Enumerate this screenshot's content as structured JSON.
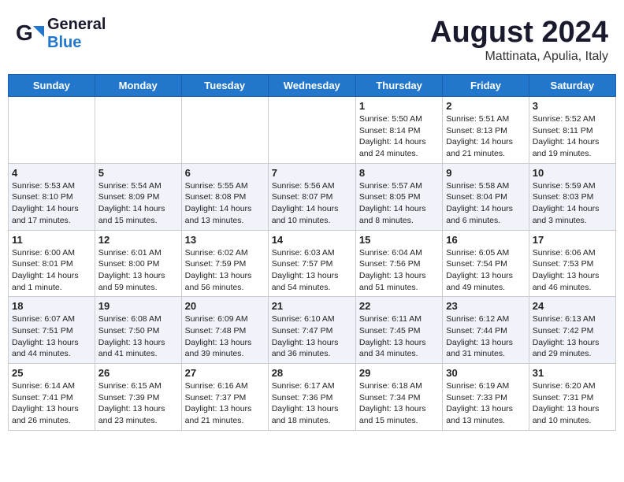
{
  "logo": {
    "general": "General",
    "blue": "Blue"
  },
  "title": "August 2024",
  "subtitle": "Mattinata, Apulia, Italy",
  "days_of_week": [
    "Sunday",
    "Monday",
    "Tuesday",
    "Wednesday",
    "Thursday",
    "Friday",
    "Saturday"
  ],
  "weeks": [
    [
      {
        "day": "",
        "content": ""
      },
      {
        "day": "",
        "content": ""
      },
      {
        "day": "",
        "content": ""
      },
      {
        "day": "",
        "content": ""
      },
      {
        "day": "1",
        "content": "Sunrise: 5:50 AM\nSunset: 8:14 PM\nDaylight: 14 hours\nand 24 minutes."
      },
      {
        "day": "2",
        "content": "Sunrise: 5:51 AM\nSunset: 8:13 PM\nDaylight: 14 hours\nand 21 minutes."
      },
      {
        "day": "3",
        "content": "Sunrise: 5:52 AM\nSunset: 8:11 PM\nDaylight: 14 hours\nand 19 minutes."
      }
    ],
    [
      {
        "day": "4",
        "content": "Sunrise: 5:53 AM\nSunset: 8:10 PM\nDaylight: 14 hours\nand 17 minutes."
      },
      {
        "day": "5",
        "content": "Sunrise: 5:54 AM\nSunset: 8:09 PM\nDaylight: 14 hours\nand 15 minutes."
      },
      {
        "day": "6",
        "content": "Sunrise: 5:55 AM\nSunset: 8:08 PM\nDaylight: 14 hours\nand 13 minutes."
      },
      {
        "day": "7",
        "content": "Sunrise: 5:56 AM\nSunset: 8:07 PM\nDaylight: 14 hours\nand 10 minutes."
      },
      {
        "day": "8",
        "content": "Sunrise: 5:57 AM\nSunset: 8:05 PM\nDaylight: 14 hours\nand 8 minutes."
      },
      {
        "day": "9",
        "content": "Sunrise: 5:58 AM\nSunset: 8:04 PM\nDaylight: 14 hours\nand 6 minutes."
      },
      {
        "day": "10",
        "content": "Sunrise: 5:59 AM\nSunset: 8:03 PM\nDaylight: 14 hours\nand 3 minutes."
      }
    ],
    [
      {
        "day": "11",
        "content": "Sunrise: 6:00 AM\nSunset: 8:01 PM\nDaylight: 14 hours\nand 1 minute."
      },
      {
        "day": "12",
        "content": "Sunrise: 6:01 AM\nSunset: 8:00 PM\nDaylight: 13 hours\nand 59 minutes."
      },
      {
        "day": "13",
        "content": "Sunrise: 6:02 AM\nSunset: 7:59 PM\nDaylight: 13 hours\nand 56 minutes."
      },
      {
        "day": "14",
        "content": "Sunrise: 6:03 AM\nSunset: 7:57 PM\nDaylight: 13 hours\nand 54 minutes."
      },
      {
        "day": "15",
        "content": "Sunrise: 6:04 AM\nSunset: 7:56 PM\nDaylight: 13 hours\nand 51 minutes."
      },
      {
        "day": "16",
        "content": "Sunrise: 6:05 AM\nSunset: 7:54 PM\nDaylight: 13 hours\nand 49 minutes."
      },
      {
        "day": "17",
        "content": "Sunrise: 6:06 AM\nSunset: 7:53 PM\nDaylight: 13 hours\nand 46 minutes."
      }
    ],
    [
      {
        "day": "18",
        "content": "Sunrise: 6:07 AM\nSunset: 7:51 PM\nDaylight: 13 hours\nand 44 minutes."
      },
      {
        "day": "19",
        "content": "Sunrise: 6:08 AM\nSunset: 7:50 PM\nDaylight: 13 hours\nand 41 minutes."
      },
      {
        "day": "20",
        "content": "Sunrise: 6:09 AM\nSunset: 7:48 PM\nDaylight: 13 hours\nand 39 minutes."
      },
      {
        "day": "21",
        "content": "Sunrise: 6:10 AM\nSunset: 7:47 PM\nDaylight: 13 hours\nand 36 minutes."
      },
      {
        "day": "22",
        "content": "Sunrise: 6:11 AM\nSunset: 7:45 PM\nDaylight: 13 hours\nand 34 minutes."
      },
      {
        "day": "23",
        "content": "Sunrise: 6:12 AM\nSunset: 7:44 PM\nDaylight: 13 hours\nand 31 minutes."
      },
      {
        "day": "24",
        "content": "Sunrise: 6:13 AM\nSunset: 7:42 PM\nDaylight: 13 hours\nand 29 minutes."
      }
    ],
    [
      {
        "day": "25",
        "content": "Sunrise: 6:14 AM\nSunset: 7:41 PM\nDaylight: 13 hours\nand 26 minutes."
      },
      {
        "day": "26",
        "content": "Sunrise: 6:15 AM\nSunset: 7:39 PM\nDaylight: 13 hours\nand 23 minutes."
      },
      {
        "day": "27",
        "content": "Sunrise: 6:16 AM\nSunset: 7:37 PM\nDaylight: 13 hours\nand 21 minutes."
      },
      {
        "day": "28",
        "content": "Sunrise: 6:17 AM\nSunset: 7:36 PM\nDaylight: 13 hours\nand 18 minutes."
      },
      {
        "day": "29",
        "content": "Sunrise: 6:18 AM\nSunset: 7:34 PM\nDaylight: 13 hours\nand 15 minutes."
      },
      {
        "day": "30",
        "content": "Sunrise: 6:19 AM\nSunset: 7:33 PM\nDaylight: 13 hours\nand 13 minutes."
      },
      {
        "day": "31",
        "content": "Sunrise: 6:20 AM\nSunset: 7:31 PM\nDaylight: 13 hours\nand 10 minutes."
      }
    ]
  ]
}
